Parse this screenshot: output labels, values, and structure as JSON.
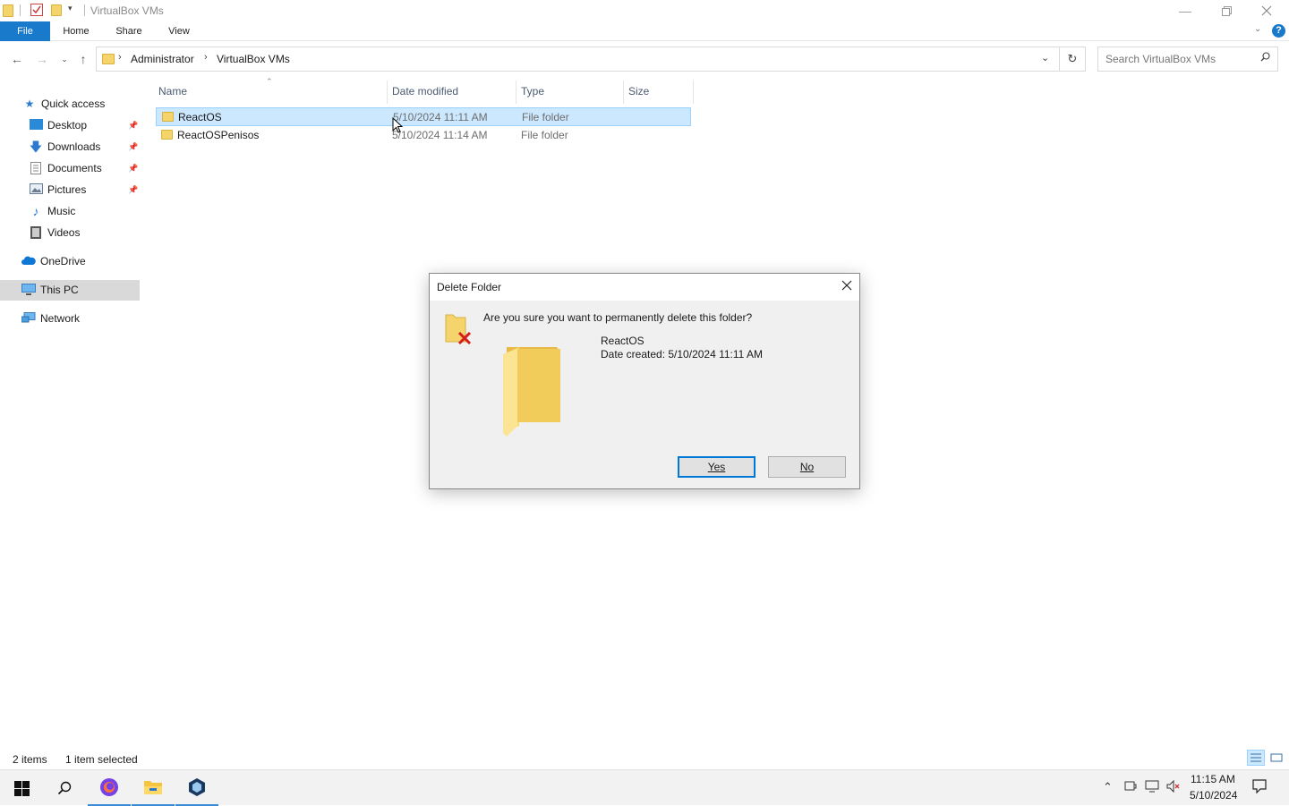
{
  "window": {
    "title": "VirtualBox VMs"
  },
  "ribbon": {
    "tabs": [
      "File",
      "Home",
      "Share",
      "View"
    ],
    "help": "?"
  },
  "address": {
    "crumbs": [
      "Administrator",
      "VirtualBox VMs"
    ],
    "search_placeholder": "Search VirtualBox VMs"
  },
  "sidebar": {
    "quick_access": "Quick access",
    "items": [
      {
        "label": "Desktop",
        "icon": "desktop-icon",
        "pinned": true
      },
      {
        "label": "Downloads",
        "icon": "downloads-icon",
        "pinned": true
      },
      {
        "label": "Documents",
        "icon": "documents-icon",
        "pinned": true
      },
      {
        "label": "Pictures",
        "icon": "pictures-icon",
        "pinned": true
      },
      {
        "label": "Music",
        "icon": "music-icon",
        "pinned": false
      },
      {
        "label": "Videos",
        "icon": "videos-icon",
        "pinned": false
      }
    ],
    "onedrive": "OneDrive",
    "this_pc": "This PC",
    "network": "Network"
  },
  "columns": [
    "Name",
    "Date modified",
    "Type",
    "Size"
  ],
  "files": [
    {
      "name": "ReactOS",
      "date": "5/10/2024 11:11 AM",
      "type": "File folder",
      "selected": true
    },
    {
      "name": "ReactOSPenisos",
      "date": "5/10/2024 11:14 AM",
      "type": "File folder",
      "selected": false
    }
  ],
  "status": {
    "items": "2 items",
    "selected": "1 item selected"
  },
  "dialog": {
    "title": "Delete Folder",
    "question": "Are you sure you want to permanently delete this folder?",
    "folder_name": "ReactOS",
    "date_created": "Date created: 5/10/2024 11:11 AM",
    "yes_label": "Yes",
    "no_label": "No"
  },
  "taskbar": {
    "time": "11:15 AM",
    "date": "5/10/2024"
  },
  "colors": {
    "accent": "#1979ca",
    "selection": "#cce8ff",
    "folder": "#f5d46b"
  }
}
